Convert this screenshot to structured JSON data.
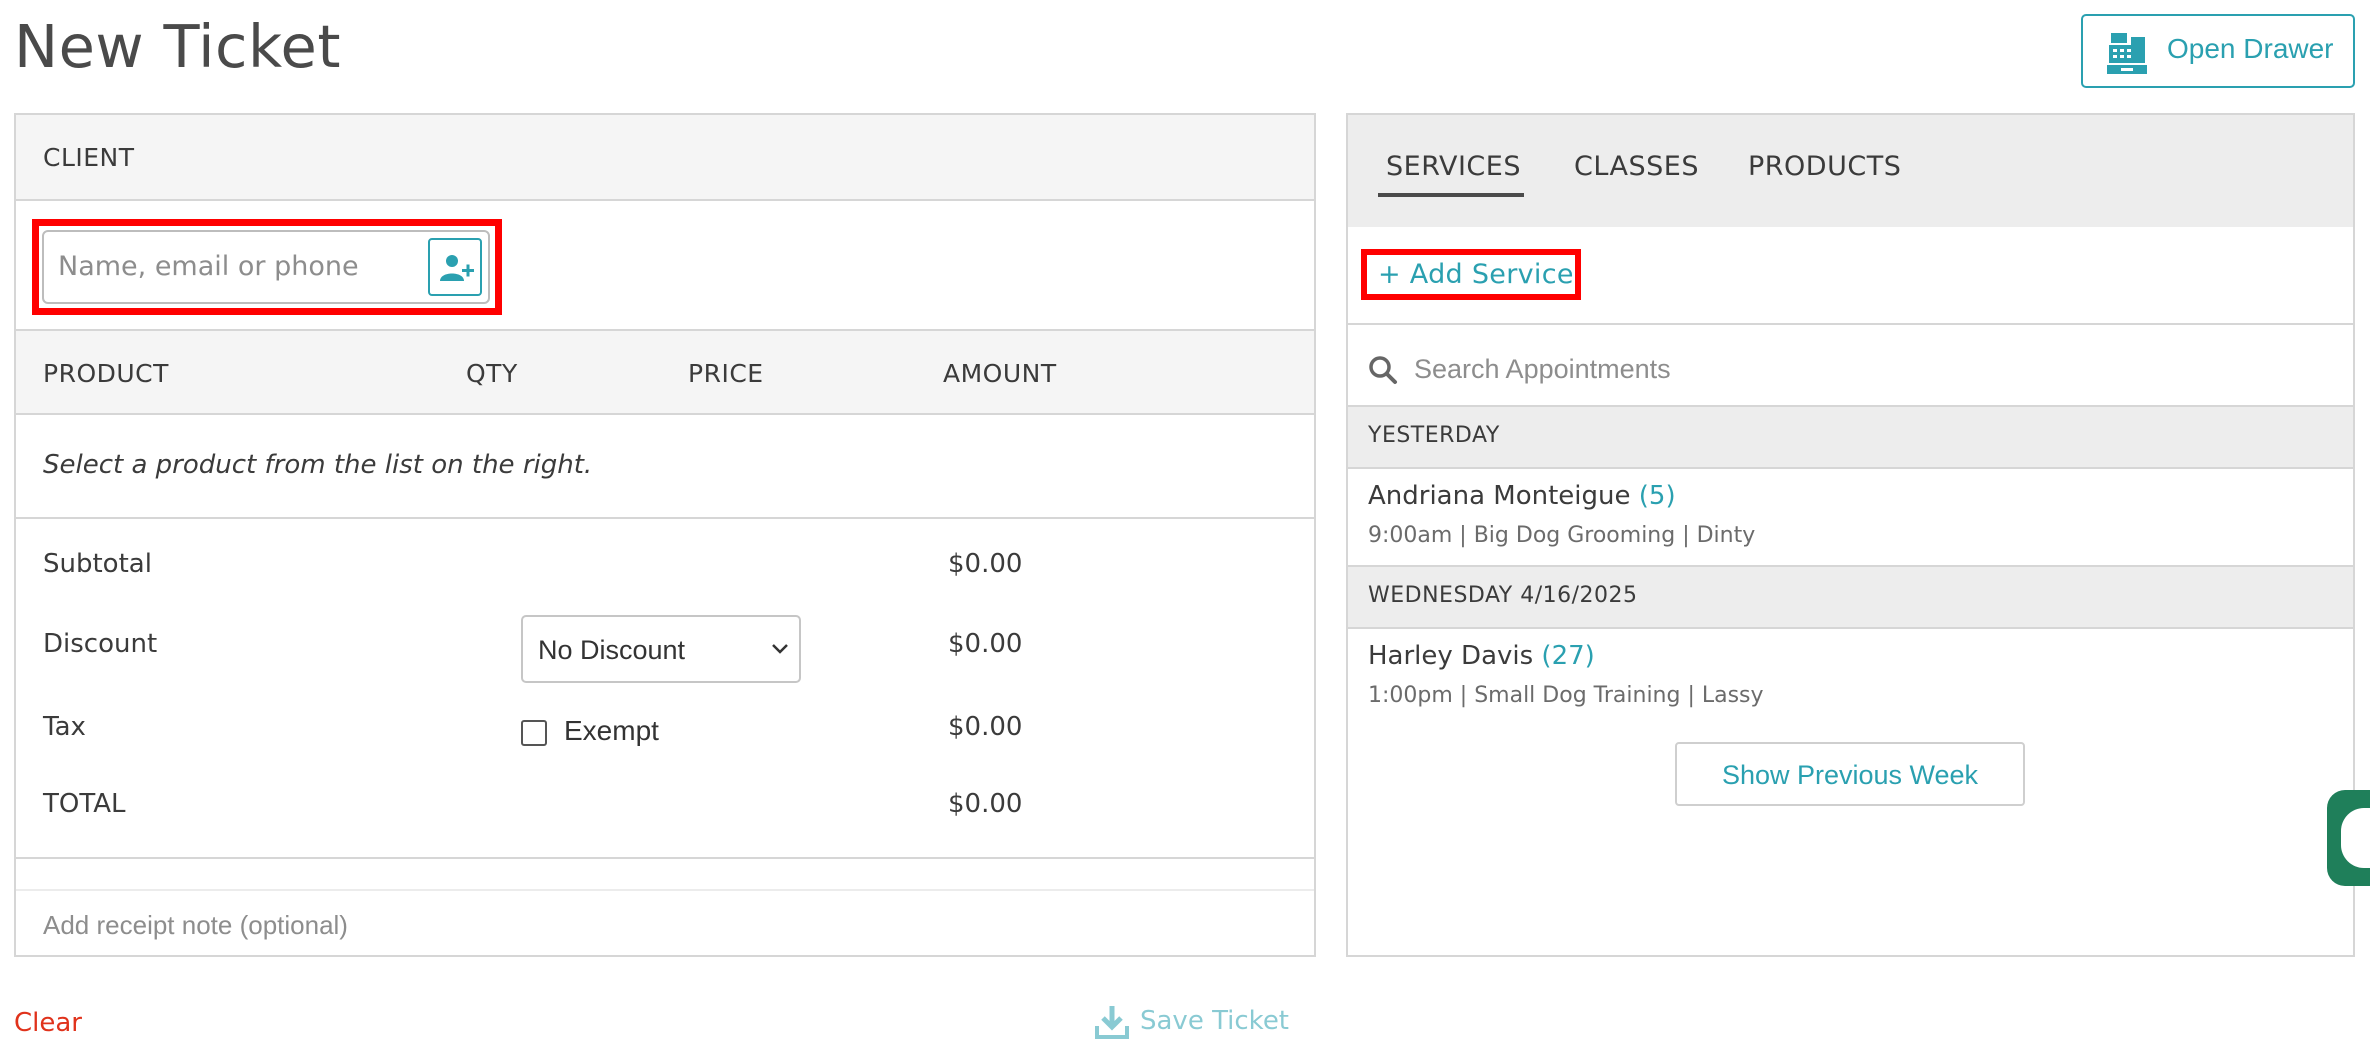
{
  "page": {
    "title": "New Ticket"
  },
  "header": {
    "open_drawer_label": "Open Drawer",
    "open_drawer_icon": "cash-register-icon"
  },
  "client": {
    "heading": "CLIENT",
    "search_placeholder": "Name, email or phone",
    "add_client_icon": "add-user-icon"
  },
  "product_table": {
    "columns": [
      "PRODUCT",
      "QTY",
      "PRICE",
      "AMOUNT"
    ],
    "empty_message": "Select a product from the list on the right."
  },
  "summary": {
    "subtotal_label": "Subtotal",
    "subtotal_value": "$0.00",
    "discount_label": "Discount",
    "discount_selected": "No Discount",
    "discount_value": "$0.00",
    "tax_label": "Tax",
    "exempt_label": "Exempt",
    "exempt_checked": false,
    "tax_value": "$0.00",
    "total_label": "TOTAL",
    "total_value": "$0.00"
  },
  "receipt_note": {
    "placeholder": "Add receipt note (optional)"
  },
  "right": {
    "tabs": [
      {
        "label": "SERVICES",
        "active": true
      },
      {
        "label": "CLASSES",
        "active": false
      },
      {
        "label": "PRODUCTS",
        "active": false
      }
    ],
    "add_service_label": "+ Add Service",
    "search_placeholder": "Search Appointments",
    "groups": [
      {
        "header": "YESTERDAY",
        "appointments": [
          {
            "name": "Andriana Monteigue",
            "count": "(5)",
            "detail": "9:00am | Big Dog Grooming | Dinty"
          }
        ]
      },
      {
        "header": "WEDNESDAY 4/16/2025",
        "appointments": [
          {
            "name": "Harley Davis",
            "count": "(27)",
            "detail": "1:00pm | Small Dog Training | Lassy"
          }
        ]
      }
    ],
    "show_previous_label": "Show Previous Week"
  },
  "footer": {
    "clear_label": "Clear",
    "save_ticket_label": "Save Ticket"
  },
  "colors": {
    "accent": "#2aa0b0",
    "danger": "#e0321b",
    "highlight": "#ff0000"
  }
}
